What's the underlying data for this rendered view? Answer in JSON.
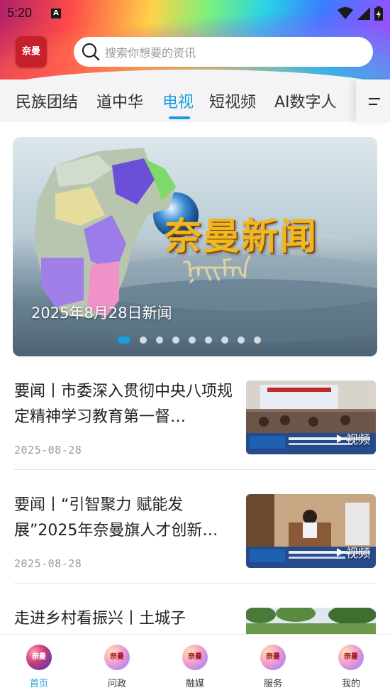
{
  "status_bar": {
    "time": "5:20",
    "app_badge": "A"
  },
  "header": {
    "logo_text": "奈曼",
    "search_placeholder": "搜索你想要的资讯"
  },
  "tabs": [
    {
      "label": "民族团结",
      "active": false
    },
    {
      "label": "道中华",
      "active": false
    },
    {
      "label": "电视",
      "active": true
    },
    {
      "label": "短视频",
      "active": false
    },
    {
      "label": "AI数字人",
      "active": false
    }
  ],
  "banner": {
    "logo_text": "奈曼新闻",
    "caption": "2025年8月28日新闻",
    "dot_count": 9,
    "active_dot": 0
  },
  "news": [
    {
      "title": "要闻丨市委深入贯彻中央八项规定精神学习教育第一督…",
      "date": "2025-08-28",
      "badge": "视频"
    },
    {
      "title": "要闻丨“引智聚力 赋能发展”2025年奈曼旗人才创新…",
      "date": "2025-08-28",
      "badge": "视频"
    },
    {
      "title": "走进乡村看振兴丨土城子",
      "date": "",
      "badge": ""
    }
  ],
  "bottom_nav": [
    {
      "label": "首页",
      "icon_text": "奈曼",
      "active": true
    },
    {
      "label": "问政",
      "icon_text": "奈曼",
      "active": false
    },
    {
      "label": "融媒",
      "icon_text": "奈曼",
      "active": false
    },
    {
      "label": "服务",
      "icon_text": "奈曼",
      "active": false
    },
    {
      "label": "我的",
      "icon_text": "奈曼",
      "active": false
    }
  ],
  "colors": {
    "accent": "#1a9de0",
    "logo_red": "#c8202a",
    "text": "#222222",
    "muted": "#999999"
  }
}
